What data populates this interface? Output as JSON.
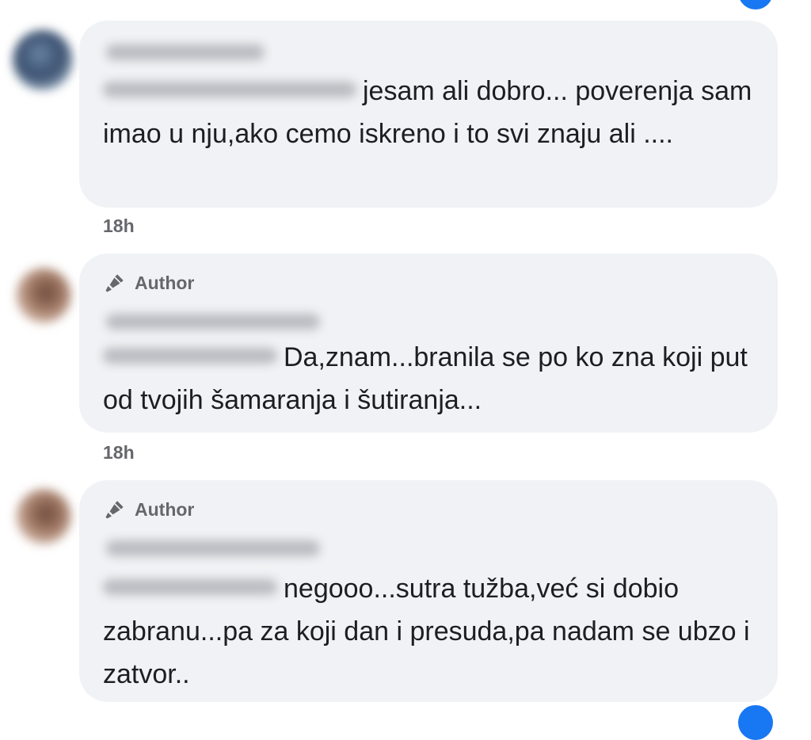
{
  "comments": [
    {
      "text": "jesam ali dobro... poverenja sam imao u nju,ako cemo iskreno i to svi znaju ali ....",
      "time": "18h"
    },
    {
      "author_label": "Author",
      "text": "Da,znam...branila se po ko zna koji put od tvojih šamaranja i šutiranja...",
      "time": "18h"
    },
    {
      "author_label": "Author",
      "text": "negooo...sutra tužba,već si dobio zabranu...pa za koji dan i presuda,pa nadam se ubzo i zatvor.."
    }
  ],
  "icons": {
    "author_badge": "mic-icon"
  },
  "colors": {
    "bubble": "#f0f2f5",
    "text": "#1c1e21",
    "meta": "#65676b",
    "accent": "#1877f2"
  }
}
